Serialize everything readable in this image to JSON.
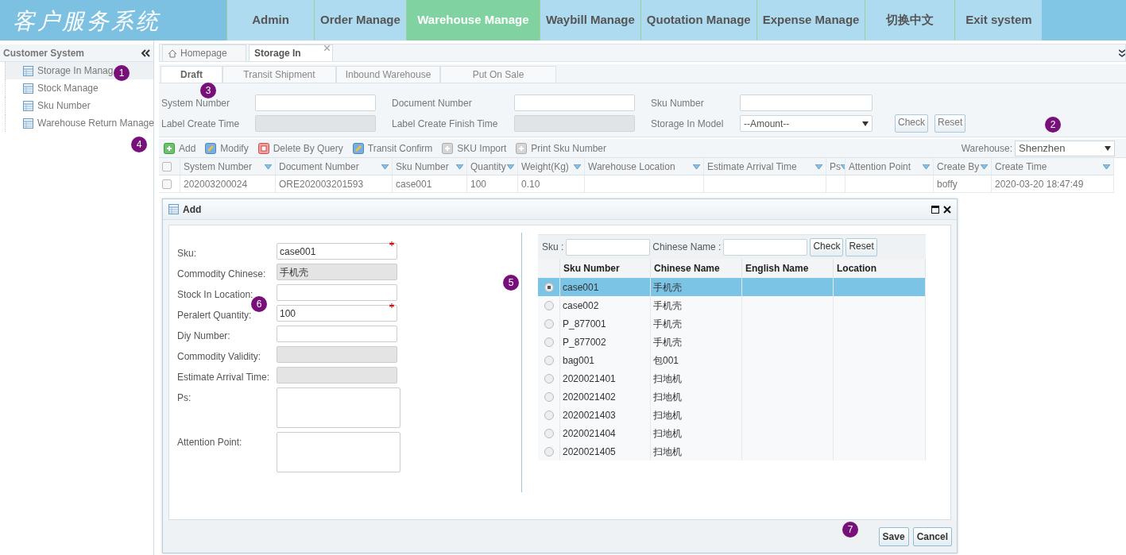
{
  "header": {
    "logo": "客户服务系统",
    "nav": [
      {
        "label": "Admin",
        "selected": false
      },
      {
        "label": "Order Manage",
        "selected": false
      },
      {
        "label": "Warehouse Manage",
        "selected": true
      },
      {
        "label": "Waybill Manage",
        "selected": false
      },
      {
        "label": "Quotation Manage",
        "selected": false
      },
      {
        "label": "Expense Manage",
        "selected": false
      },
      {
        "label": "切换中文",
        "selected": false
      },
      {
        "label": "Exit system",
        "selected": false
      }
    ]
  },
  "sidebar": {
    "title": "Customer System",
    "items": [
      {
        "label": "Storage In Manag",
        "selected": true
      },
      {
        "label": "Stock Manage",
        "selected": false
      },
      {
        "label": "Sku Number",
        "selected": false
      },
      {
        "label": "Warehouse Return Manage",
        "selected": false
      }
    ]
  },
  "tabs": [
    {
      "label": "Homepage",
      "selected": false,
      "kind": "home"
    },
    {
      "label": "Storage In",
      "selected": true,
      "kind": "closable"
    }
  ],
  "subtabs": [
    {
      "label": "Draft",
      "selected": true
    },
    {
      "label": "Transit Shipment",
      "selected": false
    },
    {
      "label": "Inbound Warehouse",
      "selected": false
    },
    {
      "label": "Put On Sale",
      "selected": false
    }
  ],
  "filters": [
    {
      "label": "System Number",
      "kind": "text",
      "disabled": false
    },
    {
      "label": "Document Number",
      "kind": "text",
      "disabled": false
    },
    {
      "label": "Sku Number",
      "kind": "text",
      "disabled": false
    },
    {
      "label": "Label Create Time",
      "kind": "text",
      "disabled": true
    },
    {
      "label": "Label Create Finish Time",
      "kind": "text",
      "disabled": true
    },
    {
      "label": "Storage In Model",
      "kind": "select",
      "value": "--Amount--",
      "disabled": false
    }
  ],
  "filter_buttons": [
    "Check",
    "Reset"
  ],
  "toolbar": {
    "buttons": [
      {
        "label": "Add",
        "kind": "add"
      },
      {
        "label": "Modify",
        "kind": "edit"
      },
      {
        "label": "Delete By Query",
        "kind": "delete"
      },
      {
        "label": "Transit Confirm",
        "kind": "edit"
      },
      {
        "label": "SKU Import",
        "kind": "import"
      },
      {
        "label": "Print Sku Number",
        "kind": "import"
      }
    ],
    "warehouse_label": "Warehouse:",
    "warehouse_value": "Shenzhen"
  },
  "grid": {
    "header_checked": false,
    "columns": [
      "System Number",
      "Document Number",
      "Sku Number",
      "Quantity",
      "Weight(Kg)",
      "Warehouse Location",
      "Estimate Arrival Time",
      "Ps",
      "Attention Point",
      "Create By",
      "Create Time"
    ],
    "rows": [
      {
        "checked": false,
        "cells": [
          "202003200024",
          "ORE202003201593",
          "case001",
          "100",
          "0.10",
          null,
          null,
          null,
          null,
          "boffy",
          "2020-03-20 18:47:49"
        ]
      }
    ]
  },
  "dialog": {
    "title": "Add",
    "form": [
      {
        "label": "Sku:",
        "kind": "input",
        "value": "case001",
        "required": true,
        "disabled": false
      },
      {
        "label": "Commodity Chinese:",
        "kind": "input",
        "value": "手机壳",
        "required": false,
        "disabled": true
      },
      {
        "label": "Stock In Location:",
        "kind": "input",
        "required": false,
        "disabled": false
      },
      {
        "label": "Peralert Quantity:",
        "kind": "input",
        "value": "100",
        "required": true,
        "disabled": false
      },
      {
        "label": "Diy Number:",
        "kind": "input",
        "required": false,
        "disabled": false
      },
      {
        "label": "Commodity Validity:",
        "kind": "input",
        "required": false,
        "disabled": true
      },
      {
        "label": "Estimate Arrival Time:",
        "kind": "input",
        "required": false,
        "disabled": true
      },
      {
        "label": "Ps:",
        "kind": "textarea",
        "required": false,
        "disabled": false
      },
      {
        "label": "Attention Point:",
        "kind": "textarea",
        "required": false,
        "disabled": false
      }
    ],
    "search": {
      "fields": [
        "Sku :",
        "Chinese Name :"
      ],
      "buttons": [
        "Check",
        "Reset"
      ]
    },
    "table": {
      "columns": [
        "Sku Number",
        "Chinese Name",
        "English Name",
        "Location"
      ],
      "rows": [
        {
          "selected": true,
          "cells": [
            "case001",
            "手机壳"
          ]
        },
        {
          "selected": false,
          "cells": [
            "case002",
            "手机壳"
          ]
        },
        {
          "selected": false,
          "cells": [
            "P_877001",
            "手机壳"
          ]
        },
        {
          "selected": false,
          "cells": [
            "P_877002",
            "手机壳"
          ]
        },
        {
          "selected": false,
          "cells": [
            "bag001",
            "包001"
          ]
        },
        {
          "selected": false,
          "cells": [
            "2020021401",
            "扫地机"
          ]
        },
        {
          "selected": false,
          "cells": [
            "2020021402",
            "扫地机"
          ]
        },
        {
          "selected": false,
          "cells": [
            "2020021403",
            "扫地机"
          ]
        },
        {
          "selected": false,
          "cells": [
            "2020021404",
            "扫地机"
          ]
        },
        {
          "selected": false,
          "cells": [
            "2020021405",
            "扫地机"
          ]
        }
      ]
    },
    "buttons": [
      "Save",
      "Cancel"
    ]
  },
  "annotations": [
    "1",
    "2",
    "3",
    "4",
    "5",
    "6",
    "7"
  ]
}
